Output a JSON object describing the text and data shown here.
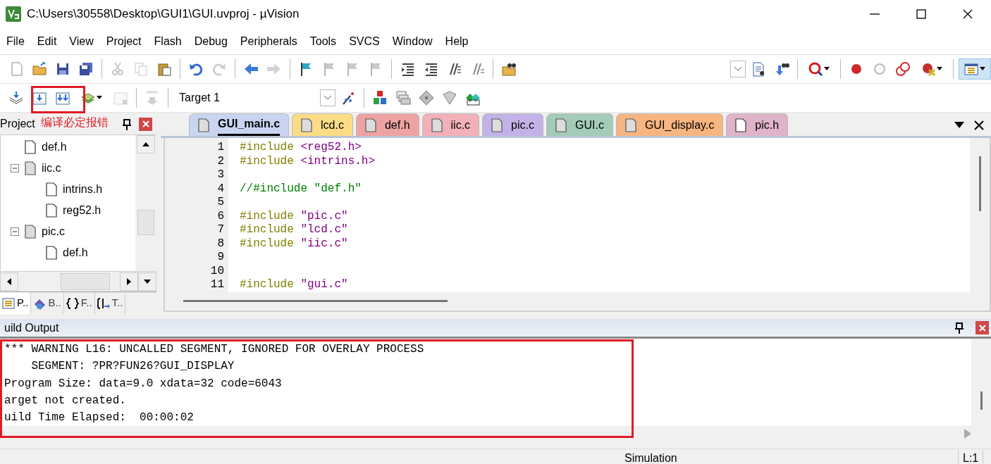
{
  "window": {
    "title": "C:\\Users\\30558\\Desktop\\GUI1\\GUI.uvproj - µVision"
  },
  "menu": [
    "File",
    "Edit",
    "View",
    "Project",
    "Flash",
    "Debug",
    "Peripherals",
    "Tools",
    "SVCS",
    "Window",
    "Help"
  ],
  "toolbar_1": [
    {
      "kind": "button",
      "disabled": false
    },
    {
      "kind": "button",
      "disabled": false
    },
    {
      "kind": "button",
      "disabled": false
    },
    {
      "kind": "button",
      "disabled": false
    },
    {
      "kind": "separator"
    },
    {
      "kind": "button",
      "disabled": true
    },
    {
      "kind": "button",
      "disabled": true
    },
    {
      "kind": "button",
      "disabled": false
    },
    {
      "kind": "separator"
    },
    {
      "kind": "button",
      "disabled": false
    },
    {
      "kind": "button",
      "disabled": true
    },
    {
      "kind": "separator"
    },
    {
      "kind": "button",
      "disabled": false
    },
    {
      "kind": "button",
      "disabled": true
    },
    {
      "kind": "separator"
    },
    {
      "kind": "button",
      "disabled": false
    },
    {
      "kind": "button",
      "disabled": true
    },
    {
      "kind": "button",
      "disabled": true
    },
    {
      "kind": "button",
      "disabled": true
    },
    {
      "kind": "separator"
    },
    {
      "kind": "button",
      "disabled": false
    },
    {
      "kind": "button",
      "disabled": false
    },
    {
      "kind": "button",
      "disabled": false
    },
    {
      "kind": "button",
      "disabled": false
    },
    {
      "kind": "separator"
    },
    {
      "kind": "button",
      "disabled": false
    },
    {
      "kind": "spacer"
    },
    {
      "kind": "combo"
    },
    {
      "kind": "button",
      "disabled": false
    },
    {
      "kind": "button",
      "disabled": false
    },
    {
      "kind": "separator"
    },
    {
      "kind": "dropdown",
      "disabled": false
    },
    {
      "kind": "separator"
    },
    {
      "kind": "button",
      "disabled": false
    },
    {
      "kind": "button",
      "disabled": false
    },
    {
      "kind": "button",
      "disabled": false
    },
    {
      "kind": "dropdown",
      "disabled": false
    },
    {
      "kind": "separator"
    },
    {
      "kind": "dropdown",
      "disabled": false,
      "selected": true
    }
  ],
  "toolbar_2": [
    {
      "kind": "button",
      "disabled": false
    },
    {
      "kind": "button",
      "disabled": false
    },
    {
      "kind": "button",
      "disabled": false
    },
    {
      "kind": "dropdown",
      "disabled": false
    },
    {
      "kind": "button",
      "disabled": true
    },
    {
      "kind": "separator"
    },
    {
      "kind": "button",
      "disabled": true
    },
    {
      "kind": "separator"
    },
    {
      "kind": "select",
      "value": "Target 1"
    },
    {
      "kind": "button",
      "disabled": false
    },
    {
      "kind": "separator"
    },
    {
      "kind": "button",
      "disabled": false
    },
    {
      "kind": "button",
      "disabled": false
    },
    {
      "kind": "button",
      "disabled": false
    },
    {
      "kind": "button",
      "disabled": false
    },
    {
      "kind": "button",
      "disabled": false
    }
  ],
  "annotation": {
    "text": "编译必定报错"
  },
  "project_panel": {
    "title": "Project",
    "tree": [
      {
        "label": "def.h"
      },
      {
        "label": "iic.c",
        "expanded": true,
        "children": [
          {
            "label": "intrins.h"
          },
          {
            "label": "reg52.h"
          }
        ]
      },
      {
        "label": "pic.c",
        "expanded": true,
        "children": [
          {
            "label": "def.h"
          }
        ]
      }
    ],
    "tabs": [
      {
        "label": "P..",
        "selected": true
      },
      {
        "label": "B..",
        "selected": false
      },
      {
        "label": "F..",
        "selected": false
      },
      {
        "label": "T..",
        "selected": false
      }
    ]
  },
  "editor": {
    "tabs": [
      {
        "label": "GUI_main.c",
        "color": "#c9d5f0",
        "selected": true
      },
      {
        "label": "lcd.c",
        "color": "#fbdc86",
        "selected": false
      },
      {
        "label": "def.h",
        "color": "#eea3a3",
        "selected": false
      },
      {
        "label": "iic.c",
        "color": "#f2b0b8",
        "selected": false
      },
      {
        "label": "pic.c",
        "color": "#c3b2e8",
        "selected": false
      },
      {
        "label": "GUI.c",
        "color": "#a3cbb7",
        "selected": false
      },
      {
        "label": "GUI_display.c",
        "color": "#f7b580",
        "selected": false
      },
      {
        "label": "pic.h",
        "color": "#dfb3c9",
        "selected": false
      }
    ],
    "lines": [
      {
        "number": "1",
        "parts": [
          {
            "kind": "directive",
            "text": "#include"
          },
          {
            "kind": "string",
            "text": " <reg52.h>"
          }
        ]
      },
      {
        "number": "2",
        "parts": [
          {
            "kind": "directive",
            "text": "#include"
          },
          {
            "kind": "string",
            "text": " <intrins.h>"
          }
        ]
      },
      {
        "number": "3"
      },
      {
        "number": "4",
        "parts": [
          {
            "kind": "comment",
            "text": "//#include \"def.h\""
          }
        ]
      },
      {
        "number": "5"
      },
      {
        "number": "6",
        "parts": [
          {
            "kind": "directive",
            "text": "#include"
          },
          {
            "kind": "string",
            "text": " \"pic.c\""
          }
        ]
      },
      {
        "number": "7",
        "parts": [
          {
            "kind": "directive",
            "text": "#include"
          },
          {
            "kind": "string",
            "text": " \"lcd.c\""
          }
        ]
      },
      {
        "number": "8",
        "parts": [
          {
            "kind": "directive",
            "text": "#include"
          },
          {
            "kind": "string",
            "text": " \"iic.c\""
          }
        ]
      },
      {
        "number": "9"
      },
      {
        "number": "10"
      },
      {
        "number": "11",
        "parts": [
          {
            "kind": "directive",
            "text": "#include"
          },
          {
            "kind": "string",
            "text": " \"gui.c\""
          }
        ]
      }
    ]
  },
  "build_output": {
    "title": "uild Output",
    "lines": [
      "*** WARNING L16: UNCALLED SEGMENT, IGNORED FOR OVERLAY PROCESS",
      "    SEGMENT: ?PR?FUN26?GUI_DISPLAY",
      "Program Size: data=9.0 xdata=32 code=6043",
      "arget not created.",
      "uild Time Elapsed:  00:00:02"
    ]
  },
  "status_bar": [
    "Simulation",
    "L:1"
  ]
}
